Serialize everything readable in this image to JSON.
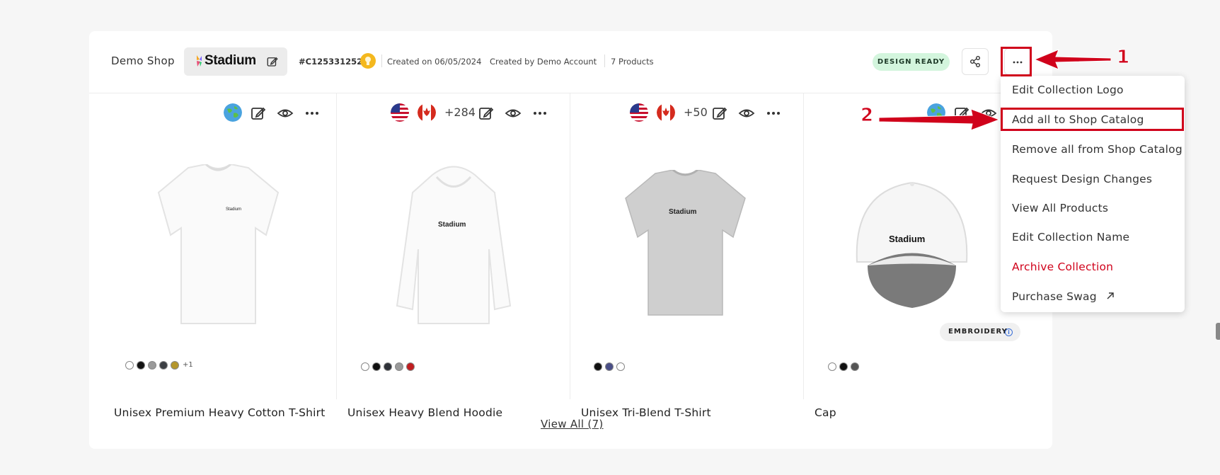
{
  "header": {
    "shop_name": "Demo Shop",
    "logo_text": "Stadium",
    "collection_id": "#C125331252",
    "created_on": "Created on 06/05/2024",
    "created_by": "Created by Demo Account",
    "product_count": "7 Products",
    "status_badge": "DESIGN READY"
  },
  "annotations": {
    "one": "1",
    "two": "2"
  },
  "products": [
    {
      "name": "Unisex Premium Heavy Cotton T-Shirt",
      "flags": [
        "globe-icon"
      ],
      "extra_countries": "",
      "swatches": [
        "#ffffff",
        "#111111",
        "#9a9a9a",
        "#3c3f44",
        "#b4962c"
      ],
      "more_colors": "+1"
    },
    {
      "name": "Unisex Heavy Blend Hoodie",
      "flags": [
        "us-flag-icon",
        "canada-flag-icon"
      ],
      "extra_countries": "+284",
      "swatches": [
        "#ffffff",
        "#111111",
        "#2e3138",
        "#9a9a9a",
        "#c01d20"
      ],
      "more_colors": ""
    },
    {
      "name": "Unisex Tri-Blend T-Shirt",
      "flags": [
        "us-flag-icon",
        "canada-flag-icon"
      ],
      "extra_countries": "+50",
      "swatches": [
        "#111111",
        "#4a4f87",
        "#ffffff"
      ],
      "more_colors": ""
    },
    {
      "name": "Cap",
      "flags": [
        "globe-icon"
      ],
      "extra_countries": "",
      "swatches": [
        "#ffffff",
        "#111111",
        "#555555"
      ],
      "more_colors": "",
      "badge": "EMBROIDERY"
    }
  ],
  "view_all_label": "View All (7)",
  "menu": {
    "items": [
      {
        "label": "Edit Collection Logo"
      },
      {
        "label": "Add all to Shop Catalog"
      },
      {
        "label": "Remove all from Shop Catalog"
      },
      {
        "label": "Request Design Changes"
      },
      {
        "label": "View All Products"
      },
      {
        "label": "Edit Collection Name"
      },
      {
        "label": "Archive Collection",
        "danger": true
      },
      {
        "label": "Purchase Swag",
        "icon": "external-arrow-icon"
      }
    ]
  },
  "colors": {
    "accent_red": "#d0021b",
    "ready_badge_bg": "#d3f5dd",
    "coin": "#f4b81e"
  }
}
